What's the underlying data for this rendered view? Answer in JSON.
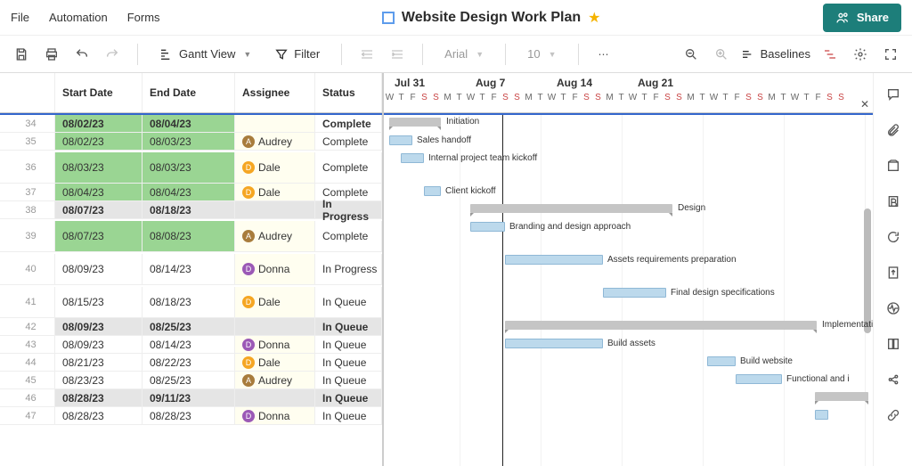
{
  "menu": {
    "file": "File",
    "automation": "Automation",
    "forms": "Forms"
  },
  "doc": {
    "title": "Website Design Work Plan"
  },
  "share": "Share",
  "toolbar": {
    "view": "Gantt View",
    "filter": "Filter",
    "font": "Arial",
    "size": "10",
    "baselines": "Baselines"
  },
  "headers": {
    "startDate": "Start Date",
    "endDate": "End Date",
    "assignee": "Assignee",
    "status": "Status"
  },
  "weeks": [
    "Jul 31",
    "Aug 7",
    "Aug 14",
    "Aug 21"
  ],
  "days": [
    "W",
    "T",
    "F",
    "S",
    "S",
    "M",
    "T",
    "W",
    "T",
    "F",
    "S",
    "S",
    "M",
    "T",
    "W",
    "T",
    "F",
    "S",
    "S",
    "M",
    "T",
    "W",
    "T",
    "F",
    "S",
    "S",
    "M",
    "T",
    "W",
    "T",
    "F",
    "S",
    "S",
    "M",
    "T",
    "W",
    "T",
    "F",
    "S",
    "S"
  ],
  "rows": [
    {
      "n": 34,
      "sd": "08/02/23",
      "ed": "08/04/23",
      "as": "",
      "st": "Complete",
      "bold": true,
      "g": true,
      "summary": true,
      "bx": 0,
      "bw": 58,
      "bl": "Initiation"
    },
    {
      "n": 35,
      "sd": "08/02/23",
      "ed": "08/03/23",
      "as": "Audrey",
      "av": "a",
      "st": "Complete",
      "g": true,
      "bx": 0,
      "bw": 26,
      "bl": "Sales handoff"
    },
    {
      "n": 36,
      "sd": "08/03/23",
      "ed": "08/03/23",
      "as": "Dale",
      "av": "d",
      "st": "Complete",
      "g": true,
      "tall": true,
      "bx": 13,
      "bw": 26,
      "bl": "Internal project team kickoff"
    },
    {
      "n": 37,
      "sd": "08/04/23",
      "ed": "08/04/23",
      "as": "Dale",
      "av": "d",
      "st": "Complete",
      "g": true,
      "bx": 39,
      "bw": 19,
      "bl": "Client kickoff"
    },
    {
      "n": 38,
      "sd": "08/07/23",
      "ed": "08/18/23",
      "as": "",
      "st": "In Progress",
      "bold": true,
      "grey": true,
      "summary": true,
      "bx": 91,
      "bw": 227,
      "bl": "Design"
    },
    {
      "n": 39,
      "sd": "08/07/23",
      "ed": "08/08/23",
      "as": "Audrey",
      "av": "a",
      "st": "Complete",
      "g": true,
      "tall": true,
      "bx": 91,
      "bw": 39,
      "bl": "Branding and design approach"
    },
    {
      "n": 40,
      "sd": "08/09/23",
      "ed": "08/14/23",
      "as": "Donna",
      "av": "do",
      "st": "In Progress",
      "tall": true,
      "bx": 130,
      "bw": 110,
      "bl": "Assets requirements preparation"
    },
    {
      "n": 41,
      "sd": "08/15/23",
      "ed": "08/18/23",
      "as": "Dale",
      "av": "d",
      "st": "In Queue",
      "tall": true,
      "bx": 240,
      "bw": 71,
      "bl": "Final design specifications"
    },
    {
      "n": 42,
      "sd": "08/09/23",
      "ed": "08/25/23",
      "as": "",
      "st": "In Queue",
      "bold": true,
      "grey": true,
      "summary": true,
      "bx": 130,
      "bw": 350,
      "bl": "Implementation"
    },
    {
      "n": 43,
      "sd": "08/09/23",
      "ed": "08/14/23",
      "as": "Donna",
      "av": "do",
      "st": "In Queue",
      "bx": 130,
      "bw": 110,
      "bl": "Build assets"
    },
    {
      "n": 44,
      "sd": "08/21/23",
      "ed": "08/22/23",
      "as": "Dale",
      "av": "d",
      "st": "In Queue",
      "bx": 357,
      "bw": 32,
      "bl": "Build website"
    },
    {
      "n": 45,
      "sd": "08/23/23",
      "ed": "08/25/23",
      "as": "Audrey",
      "av": "a",
      "st": "In Queue",
      "bx": 389,
      "bw": 52,
      "bl": "Functional and i"
    },
    {
      "n": 46,
      "sd": "08/28/23",
      "ed": "09/11/23",
      "as": "",
      "st": "In Queue",
      "bold": true,
      "grey": true,
      "summary": true,
      "bx": 478,
      "bw": 60,
      "bl": ""
    },
    {
      "n": 47,
      "sd": "08/28/23",
      "ed": "08/28/23",
      "as": "Donna",
      "av": "do",
      "st": "In Queue",
      "bx": 478,
      "bw": 15,
      "bl": ""
    }
  ]
}
